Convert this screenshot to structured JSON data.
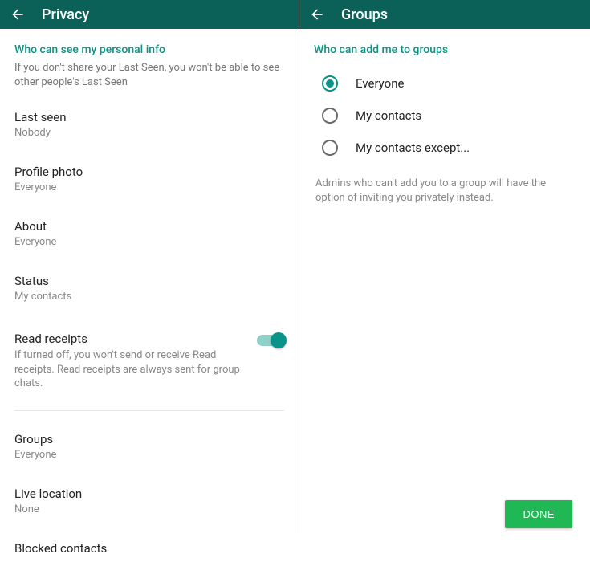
{
  "privacy": {
    "header_title": "Privacy",
    "section_title": "Who can see my personal info",
    "section_helper": "If you don't share your Last Seen, you won't be able to see other people's Last Seen",
    "last_seen": {
      "title": "Last seen",
      "value": "Nobody"
    },
    "profile_photo": {
      "title": "Profile photo",
      "value": "Everyone"
    },
    "about": {
      "title": "About",
      "value": "Everyone"
    },
    "status": {
      "title": "Status",
      "value": "My contacts"
    },
    "read_receipts": {
      "title": "Read receipts",
      "desc": "If turned off, you won't send or receive Read receipts. Read receipts are always sent for group chats.",
      "enabled": true
    },
    "groups": {
      "title": "Groups",
      "value": "Everyone"
    },
    "live_location": {
      "title": "Live location",
      "value": "None"
    },
    "blocked_contacts": {
      "title": "Blocked contacts"
    }
  },
  "groups": {
    "header_title": "Groups",
    "section_title": "Who can add me to groups",
    "options": {
      "0": {
        "label": "Everyone",
        "selected": true
      },
      "1": {
        "label": "My contacts",
        "selected": false
      },
      "2": {
        "label": "My contacts except...",
        "selected": false
      }
    },
    "helper": "Admins who can't add you to a group will have the option of inviting you privately instead.",
    "done_label": "DONE"
  }
}
